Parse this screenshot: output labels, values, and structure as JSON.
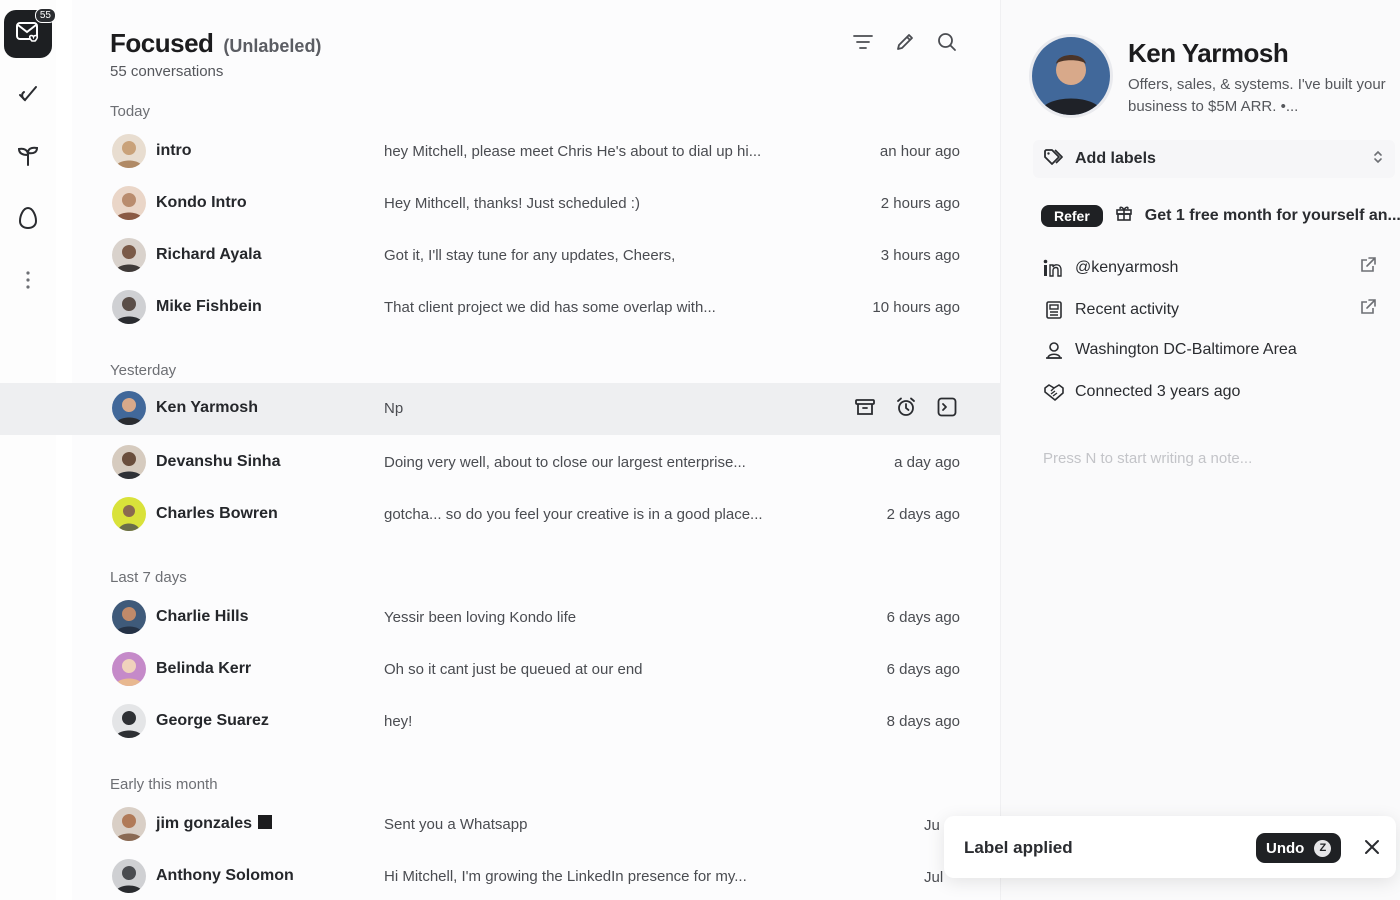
{
  "rail": {
    "inbox_badge": "55",
    "items": [
      {
        "icon": "mail-heart-icon"
      },
      {
        "icon": "check-leaf-icon"
      },
      {
        "icon": "sprout-icon"
      },
      {
        "icon": "egg-icon"
      },
      {
        "icon": "more-vertical-icon"
      }
    ]
  },
  "header": {
    "title": "Focused",
    "subtitle_tag": "(Unlabeled)",
    "count": "55 conversations",
    "tools": [
      "filter-icon",
      "edit-icon",
      "search-icon"
    ]
  },
  "sections": [
    {
      "label": "Today"
    },
    {
      "label": "Yesterday"
    },
    {
      "label": "Last 7 days"
    },
    {
      "label": "Early this month"
    }
  ],
  "conversations": [
    {
      "name": "intro",
      "preview": "hey Mitchell, please meet Chris He's about to dial up hi...",
      "time": "an hour ago",
      "avatar_color": "#c9a27a"
    },
    {
      "name": "Kondo Intro",
      "preview": "Hey Mithcell, thanks! Just scheduled :)",
      "time": "2 hours ago",
      "avatar_color": "#b98c6e"
    },
    {
      "name": "Richard Ayala",
      "preview": "Got it, I'll stay tune for any updates, Cheers,",
      "time": "3 hours ago",
      "avatar_color": "#7a5a48"
    },
    {
      "name": "Mike Fishbein",
      "preview": "That client project we did has some overlap with...",
      "time": "10 hours ago",
      "avatar_color": "#3b3d42"
    },
    {
      "name": "Ken Yarmosh",
      "preview": "Np",
      "time": "",
      "avatar_color": "#41689a"
    },
    {
      "name": "Devanshu Sinha",
      "preview": "Doing very well, about to close our largest enterprise...",
      "time": "a day ago",
      "avatar_color": "#6a4e3c"
    },
    {
      "name": "Charles Bowren",
      "preview": "gotcha... so do you feel your creative is in a good place...",
      "time": "2 days ago",
      "avatar_color": "#d9e23a"
    },
    {
      "name": "Charlie Hills",
      "preview": "Yessir been loving Kondo life",
      "time": "6 days ago",
      "avatar_color": "#3f5a7a"
    },
    {
      "name": "Belinda Kerr",
      "preview": "Oh so it cant just be queued at our end",
      "time": "6 days ago",
      "avatar_color": "#c58ac9"
    },
    {
      "name": "George Suarez",
      "preview": "hey!",
      "time": "8 days ago",
      "avatar_color": "#2e3034"
    },
    {
      "name": "jim gonzales",
      "preview": "Sent you a Whatsapp",
      "time": "Ju",
      "avatar_color": "#b07a58"
    },
    {
      "name": "Anthony Solomon",
      "preview": "Hi Mitchell, I'm growing the LinkedIn presence for my...",
      "time": "Jul",
      "avatar_color": "#4a4c50"
    }
  ],
  "row_actions": [
    "archive-icon",
    "alarm-icon",
    "reply-icon"
  ],
  "profile": {
    "name": "Ken Yarmosh",
    "bio": "Offers, sales, & systems. I've built your business to $5M ARR. •...",
    "add_labels": "Add labels",
    "refer_pill": "Refer",
    "refer_text": "Get 1 free month for yourself an...",
    "linkedin": "@kenyarmosh",
    "recent_activity": "Recent activity",
    "location": "Washington DC-Baltimore Area",
    "connected": "Connected 3 years ago",
    "note_placeholder": "Press N to start writing a note..."
  },
  "toast": {
    "message": "Label applied",
    "undo_label": "Undo",
    "undo_key": "Z"
  },
  "colors": {
    "dark": "#1f2124",
    "selected_row": "#eeeff1",
    "muted_text": "#6d6f74"
  }
}
